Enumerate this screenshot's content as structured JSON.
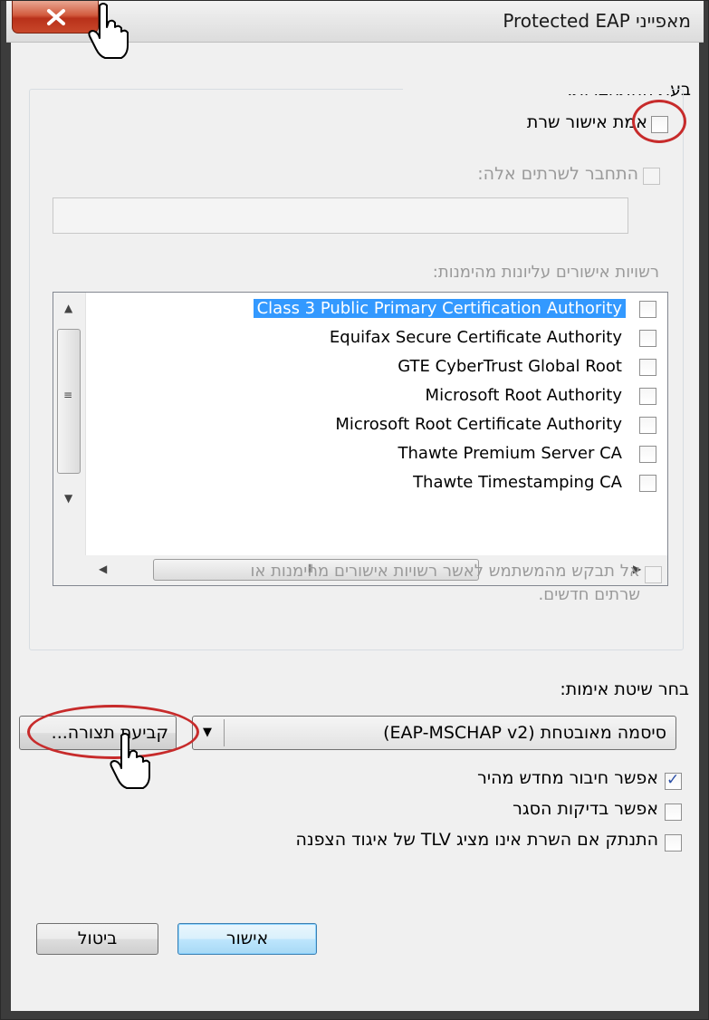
{
  "window": {
    "title": "מאפייני Protected EAP"
  },
  "connect_section": {
    "heading": "בעת ההתחברות:",
    "validate_cert_label": "אמת אישור שרת",
    "validate_cert_checked": false,
    "connect_servers_label": "התחבר לשרתים אלה:",
    "connect_servers_checked": false,
    "servers_value": "",
    "trusted_ca_label": "רשויות אישורים עליונות מהימנות:",
    "ca_items": [
      {
        "name": "Class 3 Public Primary Certification Authority",
        "checked": false,
        "selected": true
      },
      {
        "name": "Equifax Secure Certificate Authority",
        "checked": false,
        "selected": false
      },
      {
        "name": "GTE CyberTrust Global Root",
        "checked": false,
        "selected": false
      },
      {
        "name": "Microsoft Root Authority",
        "checked": false,
        "selected": false
      },
      {
        "name": "Microsoft Root Certificate Authority",
        "checked": false,
        "selected": false
      },
      {
        "name": "Thawte Premium Server CA",
        "checked": false,
        "selected": false
      },
      {
        "name": "Thawte Timestamping CA",
        "checked": false,
        "selected": false
      }
    ],
    "no_prompt_line1": "אל תבקש מהמשתמש לאשר רשויות אישורים מהימנות או",
    "no_prompt_line2": "שרתים חדשים.",
    "no_prompt_checked": false
  },
  "auth_section": {
    "heading": "בחר שיטת אימות:",
    "method_selected": "סיסמה מאובטחת (EAP-MSCHAP v2)",
    "configure_button": "קביעת תצורה...",
    "fast_reconnect_label": "אפשר חיבור מחדש מהיר",
    "fast_reconnect_checked": true,
    "quarantine_label": "אפשר בדיקות הסגר",
    "quarantine_checked": false,
    "disconnect_label": "התנתק אם השרת אינו מציג TLV של איגוד הצפנה",
    "disconnect_checked": false
  },
  "buttons": {
    "ok": "אישור",
    "cancel": "ביטול"
  },
  "colors": {
    "selection": "#3399ff",
    "highlight_ring": "#c72b2b",
    "close_button": "#c8472a"
  }
}
